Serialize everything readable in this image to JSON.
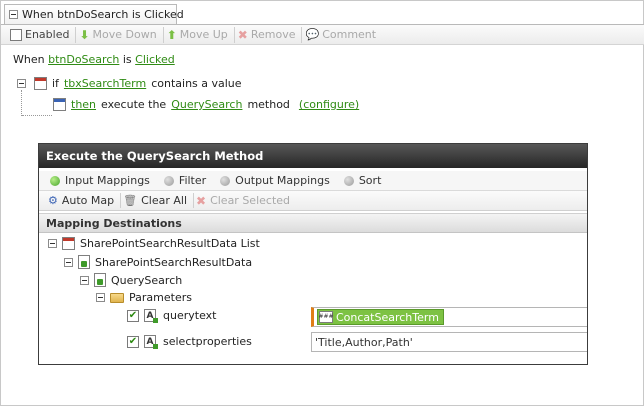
{
  "tab": {
    "title": "When btnDoSearch is Clicked"
  },
  "toolbar": {
    "enabled_label": "Enabled",
    "move_down_label": "Move Down",
    "move_up_label": "Move Up",
    "remove_label": "Remove",
    "comment_label": "Comment"
  },
  "rule": {
    "when_text": "When",
    "control_name": "btnDoSearch",
    "is_text": "is",
    "event_name": "Clicked",
    "condition": {
      "if_text": "if",
      "control": "tbxSearchTerm",
      "contains_text": "contains a value"
    },
    "action": {
      "then_text": "then",
      "execute_text": "execute the",
      "method": "QuerySearch",
      "method_text": "method",
      "configure_text": "(configure)"
    }
  },
  "dialog": {
    "title": "Execute the QuerySearch Method",
    "tabs": [
      {
        "label": "Input Mappings"
      },
      {
        "label": "Filter"
      },
      {
        "label": "Output Mappings"
      },
      {
        "label": "Sort"
      }
    ],
    "toolbar": {
      "auto_map": "Auto Map",
      "clear_all": "Clear All",
      "clear_selected": "Clear Selected"
    },
    "section_title": "Mapping Destinations",
    "tree": {
      "list": "SharePointSearchResultData List",
      "object": "SharePointSearchResultData",
      "method": "QuerySearch",
      "parameters": "Parameters",
      "param1": "querytext",
      "param2": "selectproperties"
    },
    "mappings": {
      "querytext_value": "ConcatSearchTerm",
      "selectproperties_value": "'Title,Author,Path'"
    }
  }
}
